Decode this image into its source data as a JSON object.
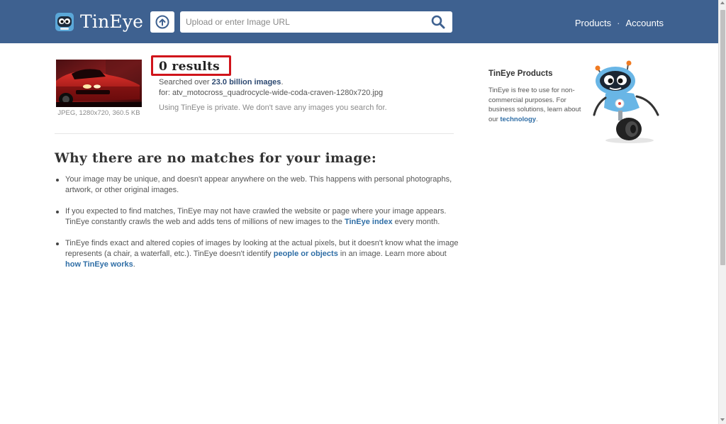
{
  "header": {
    "brand": "TinEye",
    "search_placeholder": "Upload or enter Image URL",
    "nav": {
      "products": "Products",
      "separator": "·",
      "accounts": "Accounts"
    },
    "icons": {
      "logo": "tineye-robot-logo",
      "upload": "upload-arrow-icon",
      "search": "search-icon"
    },
    "colors": {
      "bar": "#3e6190"
    }
  },
  "result": {
    "count": "0 results",
    "searched_prefix": "Searched over ",
    "searched_amount": "23.0 billion images",
    "searched_suffix": ".",
    "file_prefix": "for: ",
    "filename": "atv_motocross_quadrocycle-wide-coda-craven-1280x720.jpg",
    "privacy": "Using TinEye is private. We don't save any images you search for.",
    "thumb_caption": "JPEG, 1280x720, 360.5 KB",
    "highlight_color": "#d0141b"
  },
  "why": {
    "title": "Why there are no matches for your image:",
    "reasons": [
      {
        "text": "Your image may be unique, and doesn't appear anywhere on the web. This happens with personal photographs, artwork, or other original images."
      },
      {
        "text_1": "If you expected to find matches, TinEye may not have crawled the website or page where your image appears. TinEye constantly crawls the web and adds tens of millions of new images to the ",
        "link_1": "TinEye index",
        "text_2": " every month."
      },
      {
        "text_1": "TinEye finds exact and altered copies of images by looking at the actual pixels, but it doesn't know what the image represents (a chair, a waterfall, etc.). TinEye doesn't identify ",
        "link_1": "people or objects",
        "text_2": " in an image. Learn more about ",
        "link_2": "how TinEye works",
        "text_3": "."
      }
    ]
  },
  "sidebar": {
    "title": "TinEye Products",
    "text": "TinEye is free to use for non-commercial purposes. For business solutions, learn about our ",
    "link": "technology",
    "text_end": ".",
    "image": "tineye-robot-mascot"
  }
}
